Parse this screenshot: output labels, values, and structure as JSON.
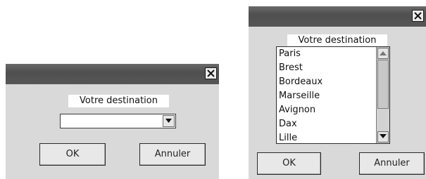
{
  "dialog_collapsed": {
    "label": "Votre destination",
    "combo_value": "",
    "ok_label": "OK",
    "cancel_label": "Annuler",
    "close_icon": "close-icon"
  },
  "dialog_expanded": {
    "label": "Votre destination",
    "list_items": [
      "Paris",
      "Brest",
      "Bordeaux",
      "Marseille",
      "Avignon",
      "Dax",
      "Lille"
    ],
    "ok_label": "OK",
    "cancel_label": "Annuler",
    "close_icon": "close-icon"
  },
  "colors": {
    "titlebar": "#555555",
    "dialog_bg": "#d9d9d9",
    "label_bg": "#ffffff"
  }
}
